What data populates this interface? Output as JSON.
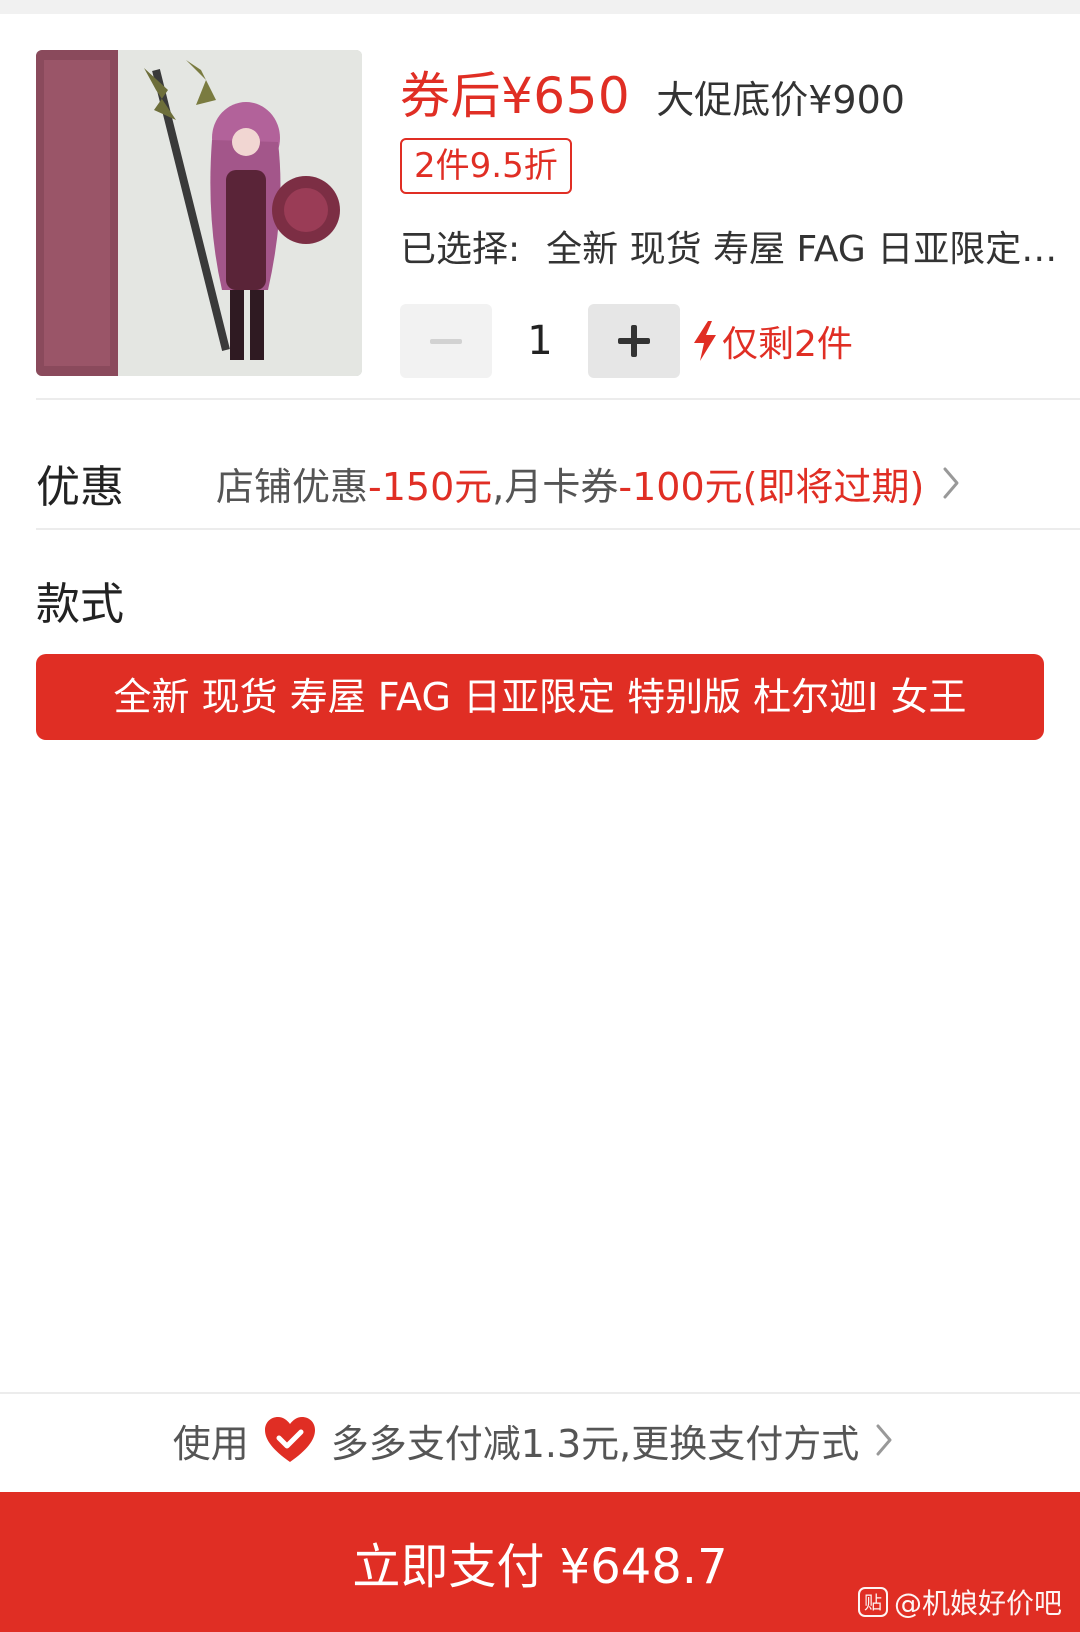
{
  "product": {
    "image_icon": "product-photo",
    "price_after_coupon": "券后¥650",
    "promo_floor_price": "大促底价¥900",
    "discount_tag": "2件9.5折",
    "selected_label": "已选择:",
    "selected_value": "全新 现货 寿屋 FAG 日亚限定 特别版 杜尔迦I 女王",
    "quantity": "1",
    "stock_warning": "仅剩2件"
  },
  "promotion": {
    "title": "优惠",
    "text_1": "店铺优惠",
    "amount_1": "-150元",
    "separator": ",",
    "text_2": "月卡券",
    "amount_2": "-100元(即将过期)"
  },
  "style": {
    "title": "款式",
    "options": [
      "全新 现货 寿屋 FAG 日亚限定 特别版 杜尔迦I 女王"
    ]
  },
  "payment": {
    "tip_prefix": "使用",
    "tip_icon": "heart-check-icon",
    "tip_text": "多多支付减1.3元,更换支付方式",
    "pay_button": "立即支付 ¥648.7"
  },
  "watermark": {
    "badge": "贴",
    "text": "@机娘好价吧"
  },
  "colors": {
    "accent": "#e02e24",
    "divider": "#ececec"
  }
}
